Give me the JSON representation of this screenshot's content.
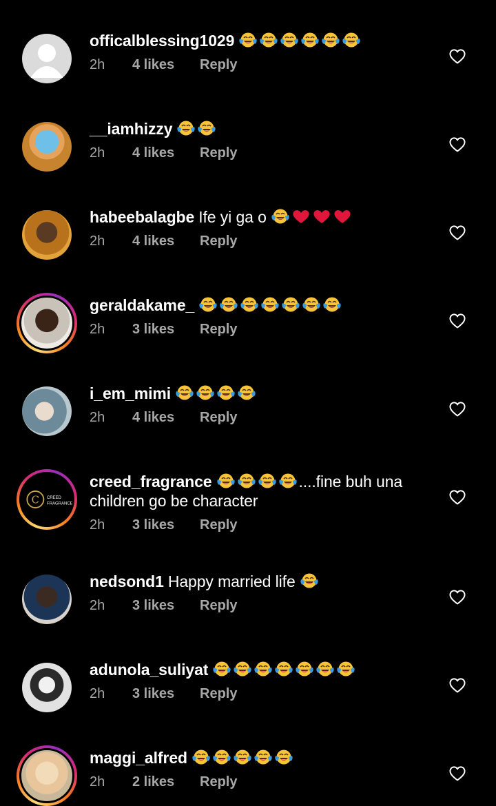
{
  "colors": {
    "background": "#000000",
    "meta_text": "#a8a8a8",
    "story_ring": [
      "#feda75",
      "#fa7e1e",
      "#d62976",
      "#962fbf"
    ],
    "emoji_face": "#f7c338",
    "emoji_tear": "#3c9be0",
    "heart_emoji": "#e0173b"
  },
  "comments": [
    {
      "user": "officalblessing1029",
      "text": "",
      "emoji": [
        "laugh",
        "laugh",
        "laugh",
        "laugh",
        "laugh",
        "laugh"
      ],
      "suffix": "",
      "time": "2h",
      "likes": "4 likes",
      "reply": "Reply",
      "avatar": "default-avatar-icon",
      "story": false
    },
    {
      "user": "__iamhizzy",
      "text": "",
      "emoji": [
        "laugh",
        "laugh"
      ],
      "suffix": "",
      "time": "2h",
      "likes": "4 likes",
      "reply": "Reply",
      "avatar": "user-photo",
      "story": false
    },
    {
      "user": "habeebalagbe",
      "text": "Ife yi ga o",
      "emoji": [
        "laugh",
        "red-heart",
        "red-heart",
        "red-heart"
      ],
      "suffix": "",
      "time": "2h",
      "likes": "4 likes",
      "reply": "Reply",
      "avatar": "user-photo",
      "story": false
    },
    {
      "user": "geraldakame_",
      "text": "",
      "emoji": [
        "laugh",
        "laugh",
        "laugh",
        "laugh",
        "laugh",
        "laugh",
        "laugh"
      ],
      "suffix": "",
      "time": "2h",
      "likes": "3 likes",
      "reply": "Reply",
      "avatar": "user-photo",
      "story": true
    },
    {
      "user": "i_em_mimi",
      "text": "",
      "emoji": [
        "laugh",
        "laugh",
        "laugh",
        "laugh"
      ],
      "suffix": "",
      "time": "2h",
      "likes": "4 likes",
      "reply": "Reply",
      "avatar": "user-photo",
      "story": false
    },
    {
      "user": "creed_fragrance",
      "text": "",
      "emoji": [
        "laugh",
        "laugh",
        "laugh",
        "laugh"
      ],
      "suffix": "....fine buh una children go be character",
      "time": "2h",
      "likes": "3 likes",
      "reply": "Reply",
      "avatar": "brand-logo",
      "story": true
    },
    {
      "user": "nedsond1",
      "text": "Happy married life",
      "emoji": [
        "laugh"
      ],
      "suffix": "",
      "time": "2h",
      "likes": "3 likes",
      "reply": "Reply",
      "avatar": "user-photo",
      "story": false
    },
    {
      "user": "adunola_suliyat",
      "text": "",
      "emoji": [
        "laugh",
        "laugh",
        "laugh",
        "laugh",
        "laugh",
        "laugh",
        "laugh"
      ],
      "suffix": "",
      "time": "2h",
      "likes": "3 likes",
      "reply": "Reply",
      "avatar": "user-photo",
      "story": false
    },
    {
      "user": "maggi_alfred",
      "text": "",
      "emoji": [
        "laugh",
        "laugh",
        "laugh",
        "laugh",
        "laugh"
      ],
      "suffix": "",
      "time": "2h",
      "likes": "2 likes",
      "reply": "Reply",
      "avatar": "user-photo",
      "story": true
    }
  ],
  "brand_logo": {
    "letter": "C",
    "line1": "CREED",
    "line2": "FRAGRANCE"
  }
}
